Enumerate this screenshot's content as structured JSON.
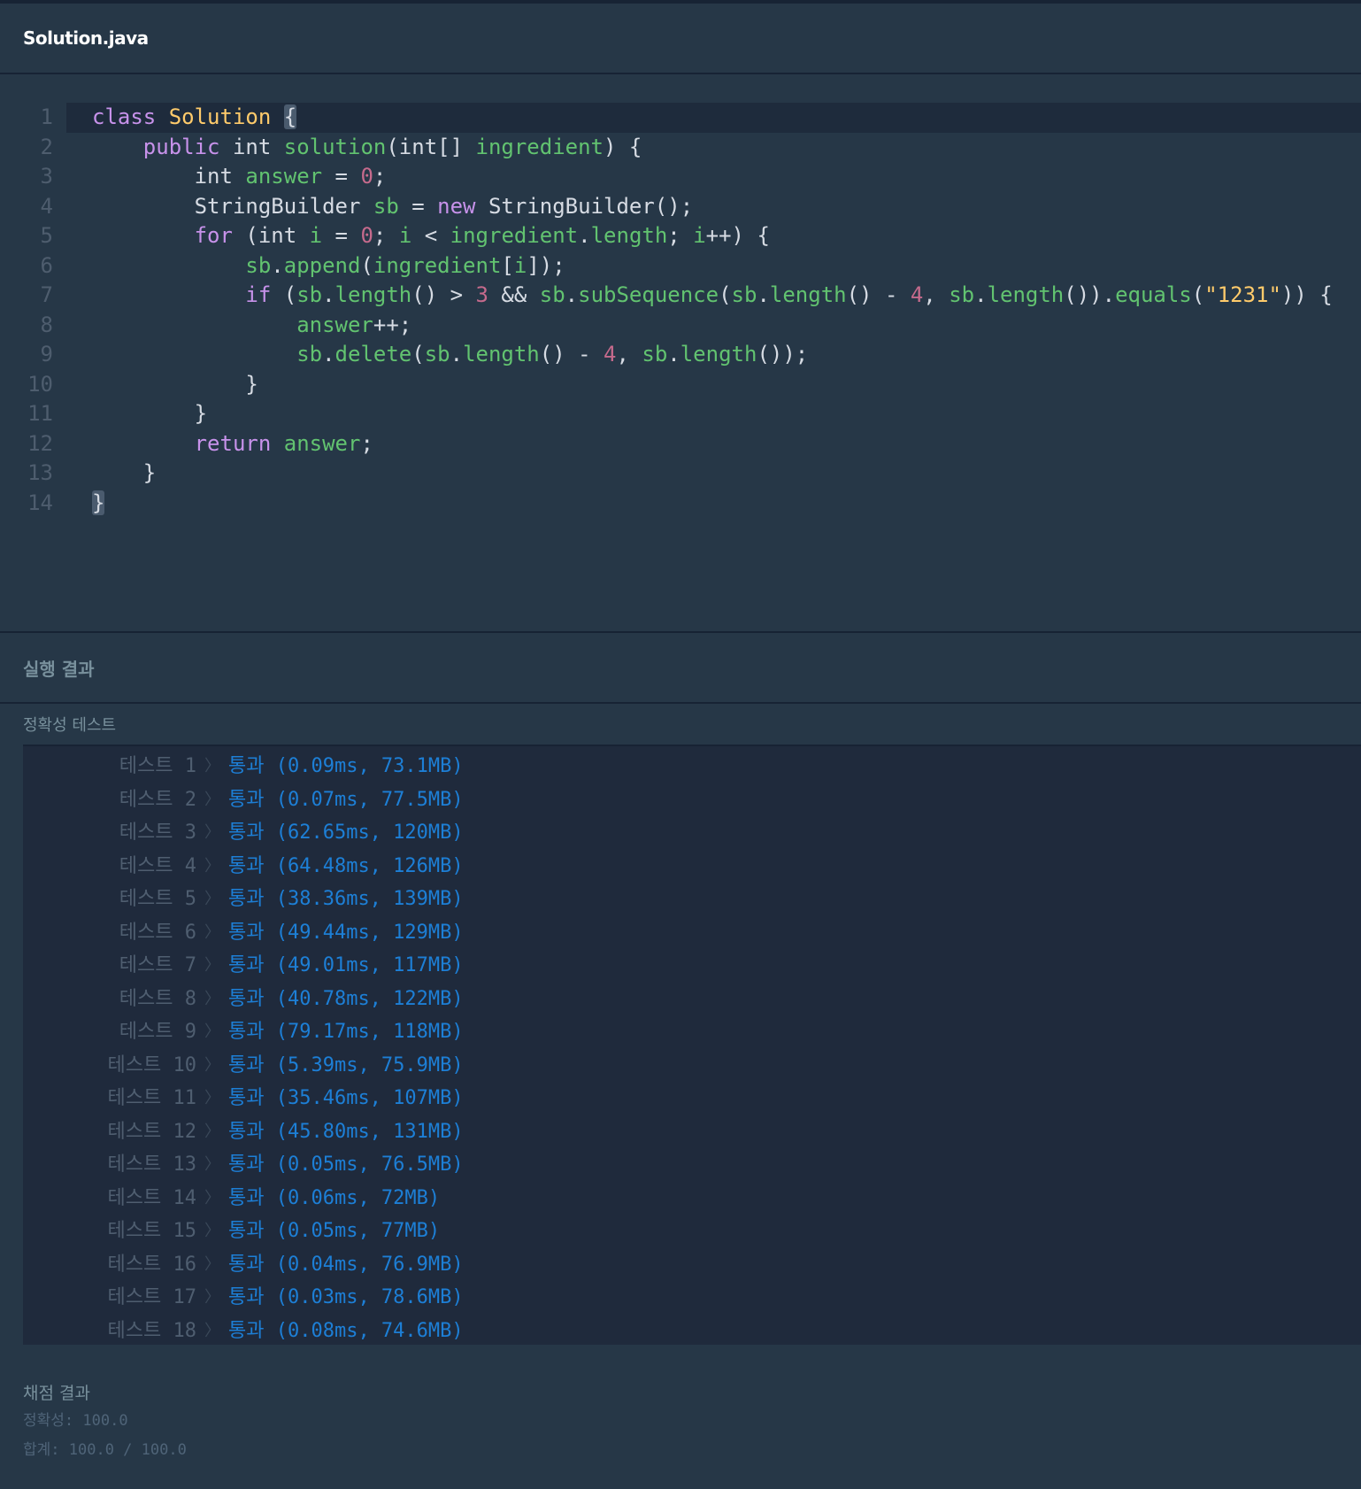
{
  "file": {
    "title": "Solution.java"
  },
  "editor": {
    "lines": [
      [
        [
          "k",
          "class"
        ],
        [
          "p",
          " "
        ],
        [
          "c",
          "Solution"
        ],
        [
          "p",
          " "
        ],
        [
          "br",
          "{"
        ]
      ],
      [
        [
          "p",
          "    "
        ],
        [
          "k",
          "public"
        ],
        [
          "p",
          " int "
        ],
        [
          "f",
          "solution"
        ],
        [
          "p",
          "(int[] "
        ],
        [
          "v",
          "ingredient"
        ],
        [
          "p",
          ") {"
        ]
      ],
      [
        [
          "p",
          "        int "
        ],
        [
          "v",
          "answer"
        ],
        [
          "p",
          " = "
        ],
        [
          "n",
          "0"
        ],
        [
          "p",
          ";"
        ]
      ],
      [
        [
          "p",
          "        StringBuilder "
        ],
        [
          "v",
          "sb"
        ],
        [
          "p",
          " = "
        ],
        [
          "k",
          "new"
        ],
        [
          "p",
          " StringBuilder();"
        ]
      ],
      [
        [
          "p",
          "        "
        ],
        [
          "k",
          "for"
        ],
        [
          "p",
          " (int "
        ],
        [
          "v",
          "i"
        ],
        [
          "p",
          " = "
        ],
        [
          "n",
          "0"
        ],
        [
          "p",
          "; "
        ],
        [
          "v",
          "i"
        ],
        [
          "p",
          " < "
        ],
        [
          "v",
          "ingredient"
        ],
        [
          "p",
          "."
        ],
        [
          "v",
          "length"
        ],
        [
          "p",
          "; "
        ],
        [
          "v",
          "i"
        ],
        [
          "p",
          "++) {"
        ]
      ],
      [
        [
          "p",
          "            "
        ],
        [
          "v",
          "sb"
        ],
        [
          "p",
          "."
        ],
        [
          "v",
          "append"
        ],
        [
          "p",
          "("
        ],
        [
          "v",
          "ingredient"
        ],
        [
          "p",
          "["
        ],
        [
          "v",
          "i"
        ],
        [
          "p",
          "]);"
        ]
      ],
      [
        [
          "p",
          "            "
        ],
        [
          "k",
          "if"
        ],
        [
          "p",
          " ("
        ],
        [
          "v",
          "sb"
        ],
        [
          "p",
          "."
        ],
        [
          "v",
          "length"
        ],
        [
          "p",
          "() > "
        ],
        [
          "n",
          "3"
        ],
        [
          "p",
          " && "
        ],
        [
          "v",
          "sb"
        ],
        [
          "p",
          "."
        ],
        [
          "v",
          "subSequence"
        ],
        [
          "p",
          "("
        ],
        [
          "v",
          "sb"
        ],
        [
          "p",
          "."
        ],
        [
          "v",
          "length"
        ],
        [
          "p",
          "() - "
        ],
        [
          "n",
          "4"
        ],
        [
          "p",
          ", "
        ],
        [
          "v",
          "sb"
        ],
        [
          "p",
          "."
        ],
        [
          "v",
          "length"
        ],
        [
          "p",
          "())."
        ],
        [
          "v",
          "equals"
        ],
        [
          "p",
          "("
        ],
        [
          "s",
          "\"1231\""
        ],
        [
          "p",
          ")) {"
        ]
      ],
      [
        [
          "p",
          "                "
        ],
        [
          "v",
          "answer"
        ],
        [
          "p",
          "++;"
        ]
      ],
      [
        [
          "p",
          "                "
        ],
        [
          "v",
          "sb"
        ],
        [
          "p",
          "."
        ],
        [
          "v",
          "delete"
        ],
        [
          "p",
          "("
        ],
        [
          "v",
          "sb"
        ],
        [
          "p",
          "."
        ],
        [
          "v",
          "length"
        ],
        [
          "p",
          "() - "
        ],
        [
          "n",
          "4"
        ],
        [
          "p",
          ", "
        ],
        [
          "v",
          "sb"
        ],
        [
          "p",
          "."
        ],
        [
          "v",
          "length"
        ],
        [
          "p",
          "());"
        ]
      ],
      [
        [
          "p",
          "            }"
        ]
      ],
      [
        [
          "p",
          "        }"
        ]
      ],
      [
        [
          "p",
          "        "
        ],
        [
          "k",
          "return"
        ],
        [
          "p",
          " "
        ],
        [
          "v",
          "answer"
        ],
        [
          "p",
          ";"
        ]
      ],
      [
        [
          "p",
          "    }"
        ]
      ],
      [
        [
          "br",
          "}"
        ]
      ]
    ]
  },
  "results": {
    "title": "실행 결과",
    "accuracy_title": "정확성  테스트",
    "tests": [
      {
        "label": "테스트 1",
        "result": "통과 (0.09ms, 73.1MB)"
      },
      {
        "label": "테스트 2",
        "result": "통과 (0.07ms, 77.5MB)"
      },
      {
        "label": "테스트 3",
        "result": "통과 (62.65ms, 120MB)"
      },
      {
        "label": "테스트 4",
        "result": "통과 (64.48ms, 126MB)"
      },
      {
        "label": "테스트 5",
        "result": "통과 (38.36ms, 139MB)"
      },
      {
        "label": "테스트 6",
        "result": "통과 (49.44ms, 129MB)"
      },
      {
        "label": "테스트 7",
        "result": "통과 (49.01ms, 117MB)"
      },
      {
        "label": "테스트 8",
        "result": "통과 (40.78ms, 122MB)"
      },
      {
        "label": "테스트 9",
        "result": "통과 (79.17ms, 118MB)"
      },
      {
        "label": "테스트 10",
        "result": "통과 (5.39ms, 75.9MB)"
      },
      {
        "label": "테스트 11",
        "result": "통과 (35.46ms, 107MB)"
      },
      {
        "label": "테스트 12",
        "result": "통과 (45.80ms, 131MB)"
      },
      {
        "label": "테스트 13",
        "result": "통과 (0.05ms, 76.5MB)"
      },
      {
        "label": "테스트 14",
        "result": "통과 (0.06ms, 72MB)"
      },
      {
        "label": "테스트 15",
        "result": "통과 (0.05ms, 77MB)"
      },
      {
        "label": "테스트 16",
        "result": "통과 (0.04ms, 76.9MB)"
      },
      {
        "label": "테스트 17",
        "result": "통과 (0.03ms, 78.6MB)"
      },
      {
        "label": "테스트 18",
        "result": "통과 (0.08ms, 74.6MB)"
      }
    ],
    "separator": "〉"
  },
  "grading": {
    "title": "채점 결과",
    "accuracy": "정확성: 100.0",
    "total": "합계: 100.0 / 100.0"
  }
}
